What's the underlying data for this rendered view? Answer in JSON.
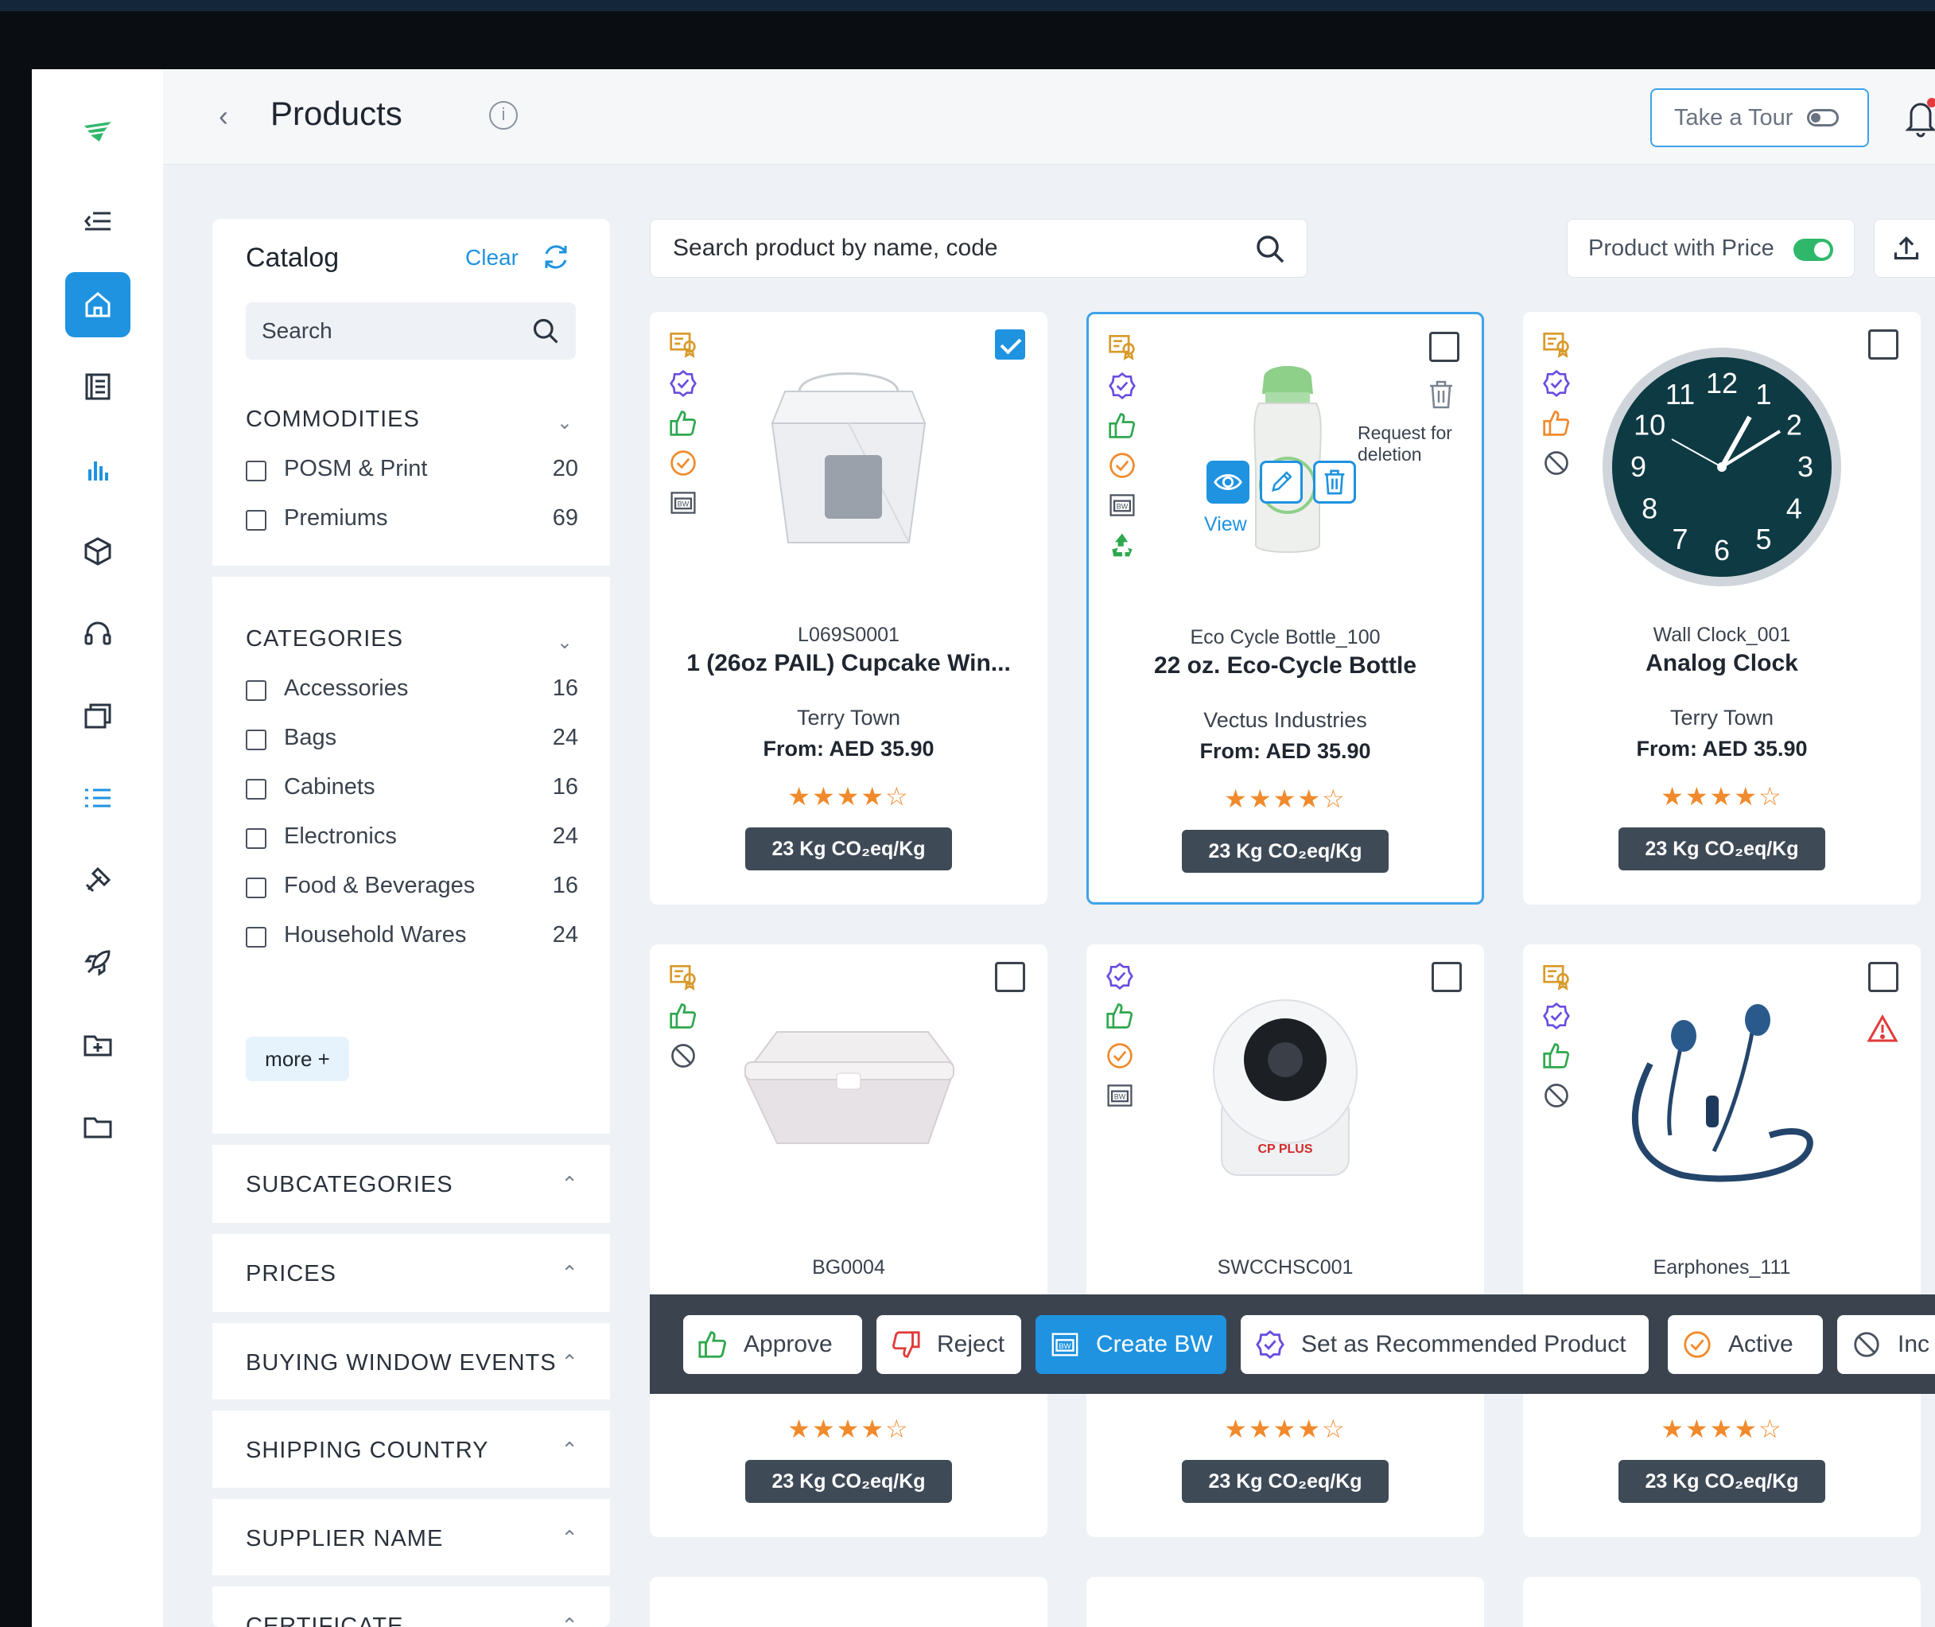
{
  "header": {
    "title": "Products",
    "tour_label": "Take a Tour"
  },
  "catalog": {
    "title": "Catalog",
    "clear": "Clear",
    "search_placeholder": "Search",
    "commodities": {
      "heading": "COMMODITIES",
      "items": [
        {
          "label": "POSM & Print",
          "count": "20"
        },
        {
          "label": "Premiums",
          "count": "69"
        }
      ]
    },
    "categories": {
      "heading": "CATEGORIES",
      "items": [
        {
          "label": "Accessories",
          "count": "16"
        },
        {
          "label": "Bags",
          "count": "24"
        },
        {
          "label": "Cabinets",
          "count": "16"
        },
        {
          "label": "Electronics",
          "count": "24"
        },
        {
          "label": "Food & Beverages",
          "count": "16"
        },
        {
          "label": "Household Wares",
          "count": "24"
        }
      ],
      "more": "more +"
    },
    "sections": [
      "SUBCATEGORIES",
      "PRICES",
      "BUYING WINDOW EVENTS",
      "SHIPPING COUNTRY",
      "SUPPLIER NAME",
      "CERTIFICATE"
    ]
  },
  "search": {
    "placeholder": "Search product by name, code"
  },
  "toggles": {
    "product_with_price": "Product with Price"
  },
  "products": [
    {
      "code": "L069S0001",
      "name": "1 (26oz PAIL) Cupcake Win...",
      "supplier": "Terry Town",
      "price": "From: AED 35.90",
      "stars": "★★★★☆",
      "co2": "23 Kg CO₂eq/Kg",
      "checked": true
    },
    {
      "code": "Eco Cycle Bottle_100",
      "name": "22 oz. Eco-Cycle Bottle",
      "supplier": "Vectus Industries",
      "price": "From: AED 35.90",
      "stars": "★★★★☆",
      "co2": "23 Kg CO₂eq/Kg",
      "checked": false
    },
    {
      "code": "Wall Clock_001",
      "name": "Analog Clock",
      "supplier": "Terry Town",
      "price": "From: AED 35.90",
      "stars": "★★★★☆",
      "co2": "23 Kg CO₂eq/Kg",
      "checked": false
    },
    {
      "code": "BG0004",
      "stars": "★★★★☆",
      "co2": "23 Kg CO₂eq/Kg",
      "checked": false
    },
    {
      "code": "SWCCHSC001",
      "stars": "★★★★☆",
      "co2": "23 Kg CO₂eq/Kg",
      "checked": false
    },
    {
      "code": "Earphones_111",
      "stars": "★★★★☆",
      "co2": "23 Kg CO₂eq/Kg",
      "checked": false
    }
  ],
  "hover": {
    "view": "View",
    "request_delete": "Request for deletion",
    "camera_brand": "CP PLUS"
  },
  "clock_numbers": [
    "12",
    "1",
    "2",
    "3",
    "4",
    "5",
    "6",
    "7",
    "8",
    "9",
    "10",
    "11"
  ],
  "actions": {
    "approve": "Approve",
    "reject": "Reject",
    "create_bw": "Create BW",
    "recommend": "Set as Recommended Product",
    "active": "Active",
    "inactive": "Inc"
  },
  "colors": {
    "accent": "#1f93e0",
    "badge_gold": "#d99a2b",
    "badge_purple": "#6a4de0",
    "badge_green": "#2fa84f",
    "badge_orange": "#f08a2c",
    "warning_red": "#e23b3b",
    "co2_chip": "#3f4a57"
  }
}
